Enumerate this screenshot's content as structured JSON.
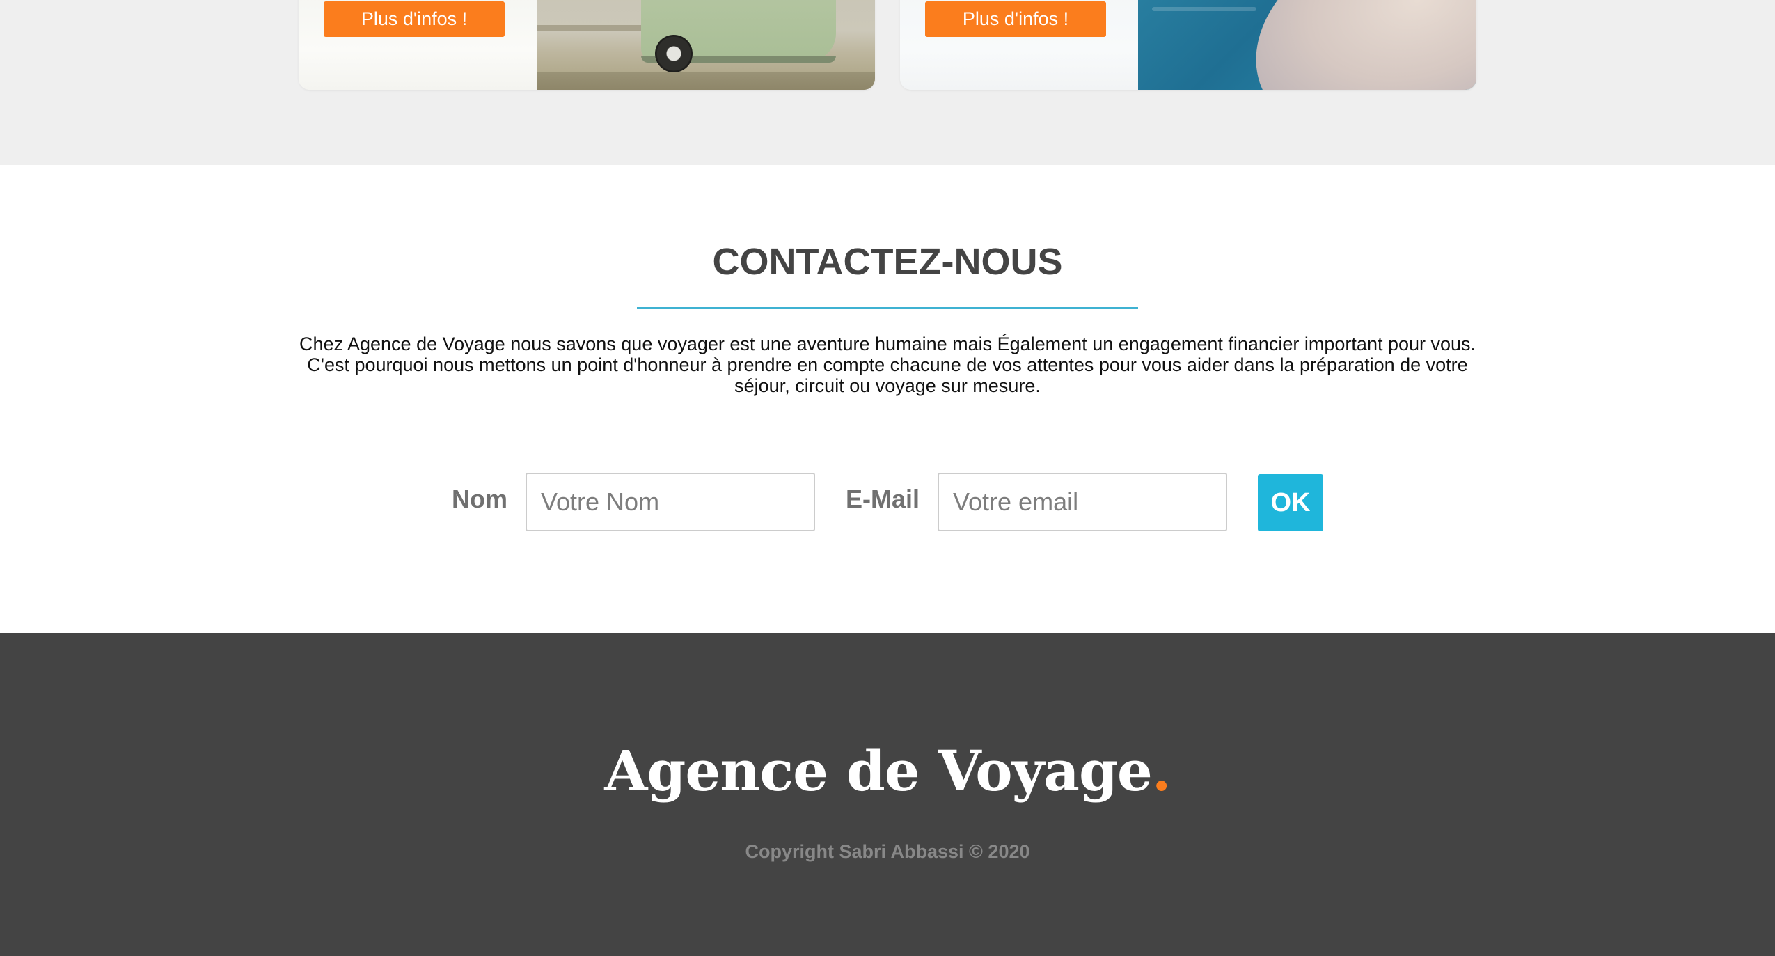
{
  "destinations": {
    "cards": [
      {
        "button_label": "Plus d'infos !",
        "image": "vintage-van-photo"
      },
      {
        "button_label": "Plus d'infos !",
        "image": "sea-rock-photo"
      }
    ]
  },
  "contact": {
    "title": "CONTACTEZ-NOUS",
    "intro": "Chez Agence de Voyage nous savons que voyager est une aventure humaine mais Également un engagement financier important pour vous. C'est pourquoi nous mettons un point d'honneur à prendre en compte chacune de vos attentes pour vous aider dans la préparation de votre séjour, circuit ou voyage sur mesure.",
    "form": {
      "name_label": "Nom",
      "name_placeholder": "Votre Nom",
      "email_label": "E-Mail",
      "email_placeholder": "Votre email",
      "submit_label": "OK"
    }
  },
  "footer": {
    "brand": "Agence de Voyage",
    "brand_dot": ".",
    "copyright": "Copyright Sabri Abbassi © 2020"
  },
  "colors": {
    "accent_orange": "#fb7d1d",
    "accent_blue": "#1fb6db",
    "underline_blue": "#3fb2d2",
    "footer_background": "#444444",
    "section_gray": "#efefef"
  }
}
